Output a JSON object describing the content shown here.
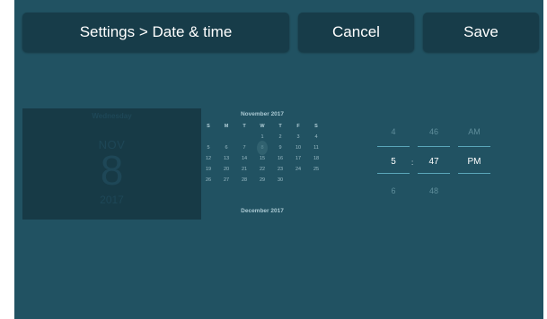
{
  "header": {
    "title": "Settings > Date & time",
    "cancel_label": "Cancel",
    "save_label": "Save"
  },
  "date_panel": {
    "weekday": "Wednesday",
    "month": "NOV",
    "day": "8",
    "year": "2017"
  },
  "calendar": {
    "month_title": "November 2017",
    "next_month_title": "December 2017",
    "weekday_headers": [
      "S",
      "M",
      "T",
      "W",
      "T",
      "F",
      "S"
    ],
    "weeks": [
      [
        "",
        "",
        "",
        "1",
        "2",
        "3",
        "4"
      ],
      [
        "5",
        "6",
        "7",
        "8",
        "9",
        "10",
        "11"
      ],
      [
        "12",
        "13",
        "14",
        "15",
        "16",
        "17",
        "18"
      ],
      [
        "19",
        "20",
        "21",
        "22",
        "23",
        "24",
        "25"
      ],
      [
        "26",
        "27",
        "28",
        "29",
        "30",
        "",
        ""
      ]
    ],
    "selected_day": "8"
  },
  "time": {
    "hour": {
      "prev": "4",
      "current": "5",
      "next": "6"
    },
    "separator": ":",
    "minute": {
      "prev": "46",
      "current": "47",
      "next": "48"
    },
    "period": {
      "prev": "AM",
      "current": "PM"
    }
  },
  "colors": {
    "background": "#215262",
    "button": "#173c49",
    "date_panel": "#173a46",
    "picker_line": "#5aa6b9"
  }
}
